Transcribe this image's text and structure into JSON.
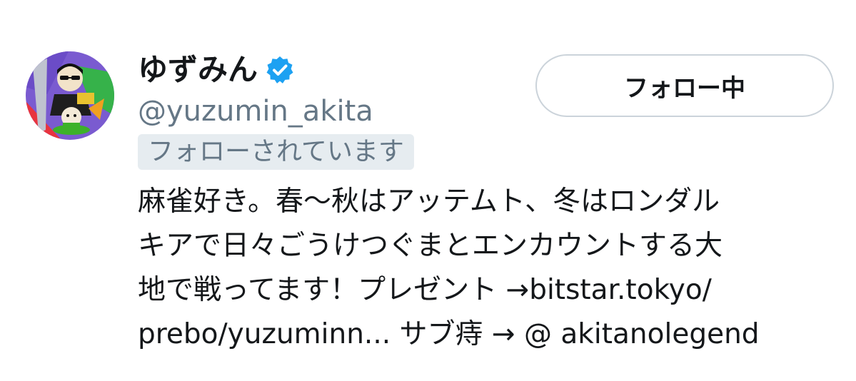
{
  "profile": {
    "display_name": "ゆずみん",
    "verified": true,
    "handle": "@yuzumin_akita",
    "follows_you_label": "フォローされています"
  },
  "actions": {
    "follow_button_label": "フォロー中"
  },
  "bio": {
    "line1": "麻雀好き。春〜秋はアッテムト、冬はロンダル",
    "line2": "キアで日々ごうけつぐまとエンカウントする大",
    "line3_text": "地で戦ってます！プレゼント →",
    "line3_link": "bitstar.tokyo/",
    "line4_link": "prebo/yuzuminn...",
    "line4_text": " サブ痔 → ",
    "line4_mention": "@ akitanolegend"
  },
  "colors": {
    "verified_blue": "#1da1f2",
    "handle_gray": "#657786",
    "badge_bg": "#e6ecf0",
    "button_border": "#cbd3da",
    "text": "#14171a"
  },
  "icons": {
    "verified": "verified-badge-icon"
  }
}
